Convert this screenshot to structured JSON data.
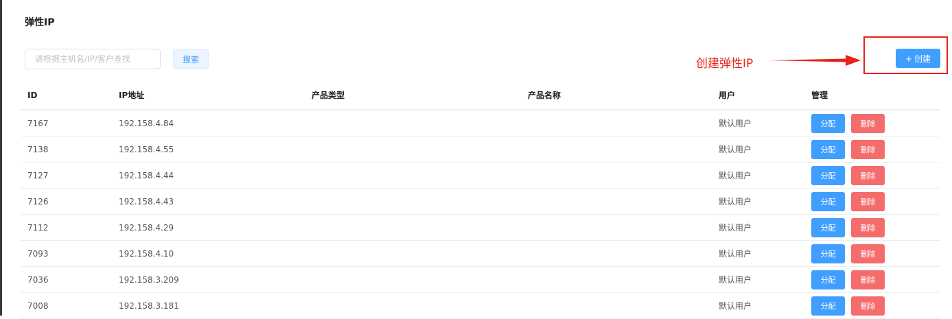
{
  "page": {
    "title": "弹性IP"
  },
  "search": {
    "placeholder": "请根据主机名/IP/客户查找",
    "button_label": "搜索"
  },
  "annotation": {
    "text": "创建弹性IP",
    "color": "#e8231a"
  },
  "toolbar": {
    "create_label": "创建",
    "create_icon": "plus-icon"
  },
  "table": {
    "headers": {
      "id": "ID",
      "ip": "IP地址",
      "product_type": "产品类型",
      "product_name": "产品名称",
      "user": "用户",
      "manage": "管理"
    },
    "assign_label": "分配",
    "delete_label": "删除",
    "rows": [
      {
        "id": "7167",
        "ip": "192.158.4.84",
        "product_type": "",
        "product_name": "",
        "user": "默认用户"
      },
      {
        "id": "7138",
        "ip": "192.158.4.55",
        "product_type": "",
        "product_name": "",
        "user": "默认用户"
      },
      {
        "id": "7127",
        "ip": "192.158.4.44",
        "product_type": "",
        "product_name": "",
        "user": "默认用户"
      },
      {
        "id": "7126",
        "ip": "192.158.4.43",
        "product_type": "",
        "product_name": "",
        "user": "默认用户"
      },
      {
        "id": "7112",
        "ip": "192.158.4.29",
        "product_type": "",
        "product_name": "",
        "user": "默认用户"
      },
      {
        "id": "7093",
        "ip": "192.158.4.10",
        "product_type": "",
        "product_name": "",
        "user": "默认用户"
      },
      {
        "id": "7036",
        "ip": "192.158.3.209",
        "product_type": "",
        "product_name": "",
        "user": "默认用户"
      },
      {
        "id": "7008",
        "ip": "192.158.3.181",
        "product_type": "",
        "product_name": "",
        "user": "默认用户"
      }
    ]
  },
  "colors": {
    "primary": "#409eff",
    "danger": "#f56c6c",
    "annotation_red": "#e8231a"
  }
}
